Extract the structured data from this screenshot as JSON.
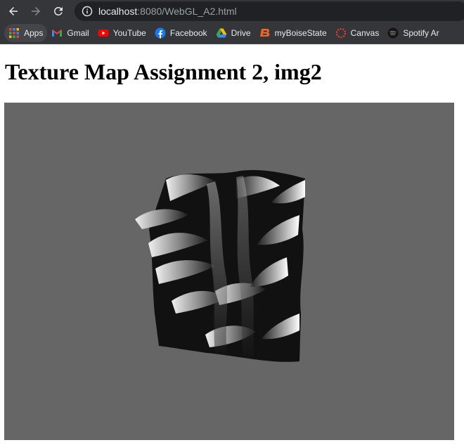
{
  "browser": {
    "url_host": "localhost",
    "url_rest": ":8080/WebGL_A2.html"
  },
  "bookmarks": [
    {
      "label": "Apps",
      "icon": "apps-grid-icon"
    },
    {
      "label": "Gmail",
      "icon": "gmail-icon"
    },
    {
      "label": "YouTube",
      "icon": "youtube-icon"
    },
    {
      "label": "Facebook",
      "icon": "facebook-icon"
    },
    {
      "label": "Drive",
      "icon": "google-drive-icon"
    },
    {
      "label": "myBoiseState",
      "icon": "boise-state-icon"
    },
    {
      "label": "Canvas",
      "icon": "canvas-icon"
    },
    {
      "label": "Spotify Ar",
      "icon": "spotify-icon"
    }
  ],
  "page": {
    "title": "Texture Map Assignment 2, img2"
  },
  "colors": {
    "chrome_bg": "#35363a",
    "omnibox_bg": "#202124",
    "canvas_bg": "#666666"
  }
}
